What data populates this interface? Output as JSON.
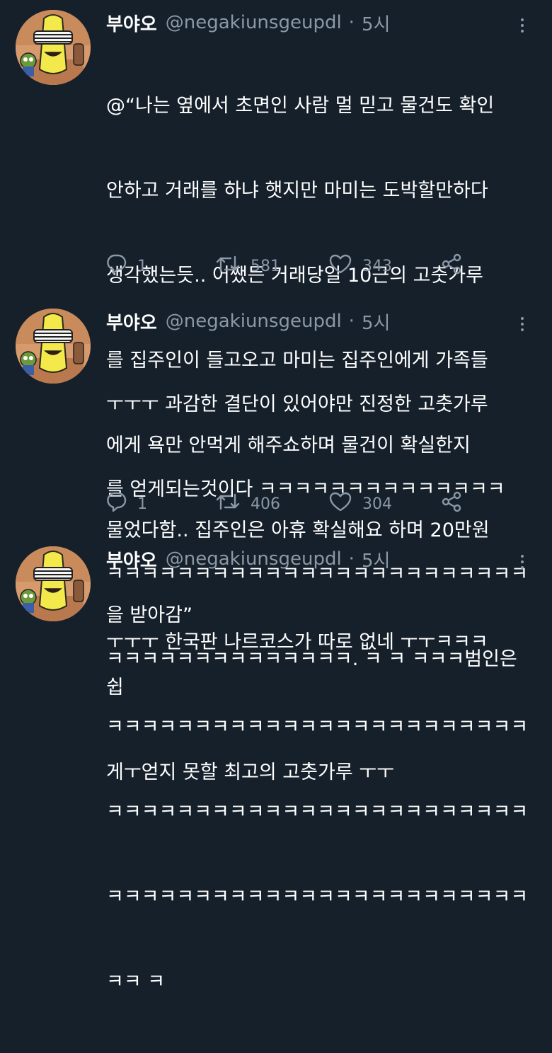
{
  "tweets": [
    {
      "name": "부야오",
      "handle": "@negakiunsgeupdl",
      "dot": "·",
      "time": "5시",
      "lines": [
        "@“나는 옆에서 초면인 사람 멀 믿고 물건도 확인",
        "안하고 거래를 하냐 햇지만 마미는 도박할만하다",
        "생각했는듯.. 어쨌든 거래당일 10근의 고춧가루",
        "를 집주인이 들고오고 마미는 집주인에게 가족들",
        "에게 욕만 안먹게 해주쇼하며 물건이 확실한지",
        "물었다함.. 집주인은 아휴 확실해요 하며 20만원",
        "을 받아감”"
      ],
      "replies": "1",
      "retweets": "581",
      "likes": "343"
    },
    {
      "name": "부야오",
      "handle": "@negakiunsgeupdl",
      "dot": "·",
      "time": "5시",
      "lines": [
        "ㅜㅜㅜ 과감한 결단이 있어야만 진정한 고춧가루",
        "를 얻게되는것이다 ㅋㅋㅋㅋㅋㅋㅋㅋㅋㅋㅋㅋㅋㅋ",
        "ㅋㅋㅋㅋㅋㅋㅋㅋㅋㅋㅋㅋㅋㅋㅋㅋㅋㅋㅋㅋㅋㅋㅋㅋ",
        "ㅋㅋㅋㅋㅋㅋㅋㅋㅋㅋㅋㅋㅋㅋ. ㅋ ㅋ ㅋㅋㅋ범인은 쉽",
        "게ㅜ얻지 못할 최고의 고춧가루 ㅜㅜ"
      ],
      "replies": "1",
      "retweets": "406",
      "likes": "304"
    },
    {
      "name": "부야오",
      "handle": "@negakiunsgeupdl",
      "dot": "·",
      "time": "5시",
      "lines": [
        "ㅜㅜㅜ 한국판 나르코스가 따로 없네 ㅜㅜㅋㅋㅋ",
        "ㅋㅋㅋㅋㅋㅋㅋㅋㅋㅋㅋㅋㅋㅋㅋㅋㅋㅋㅋㅋㅋㅋㅋㅋ",
        "ㅋㅋㅋㅋㅋㅋㅋㅋㅋㅋㅋㅋㅋㅋㅋㅋㅋㅋㅋㅋㅋㅋㅋㅋ",
        "ㅋㅋㅋㅋㅋㅋㅋㅋㅋㅋㅋㅋㅋㅋㅋㅋㅋㅋㅋㅋㅋㅋㅋㅋ",
        "ㅋㅋ ㅋ"
      ]
    }
  ],
  "colors": {
    "background": "#15202b",
    "text": "#ffffff",
    "secondary": "#8b98a5"
  },
  "icons": [
    "more-icon",
    "reply-icon",
    "retweet-icon",
    "like-icon",
    "share-icon"
  ]
}
